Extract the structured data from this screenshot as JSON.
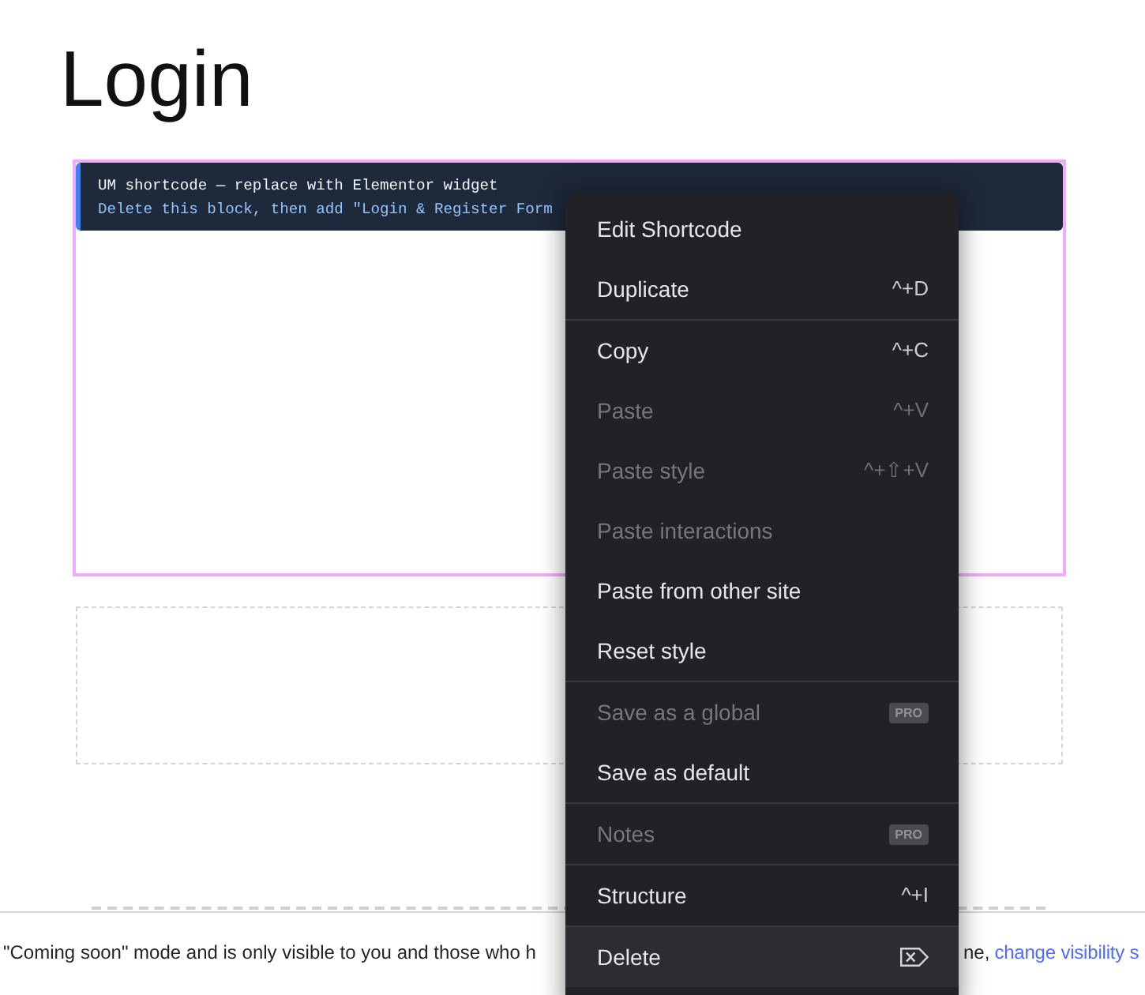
{
  "page": {
    "title": "Login"
  },
  "shortcode_block": {
    "selected": true,
    "lines": [
      {
        "text": "UM shortcode — replace with Elementor widget",
        "kind": "heading"
      },
      {
        "text": "Delete this block, then add \"Login & Register Form",
        "kind": "hint"
      }
    ]
  },
  "context_menu": {
    "groups": [
      {
        "items": [
          {
            "label": "Edit Shortcode",
            "kind": "plain",
            "disabled": false,
            "highlighted": false
          },
          {
            "label": "Duplicate",
            "kind": "shortcut",
            "shortcut": "^+D",
            "disabled": false,
            "highlighted": false
          }
        ]
      },
      {
        "items": [
          {
            "label": "Copy",
            "kind": "shortcut",
            "shortcut": "^+C",
            "disabled": false,
            "highlighted": false
          },
          {
            "label": "Paste",
            "kind": "shortcut",
            "shortcut": "^+V",
            "disabled": true,
            "highlighted": false
          },
          {
            "label": "Paste style",
            "kind": "shortcut",
            "shortcut": "^+⇧+V",
            "disabled": true,
            "highlighted": false
          },
          {
            "label": "Paste interactions",
            "kind": "plain",
            "disabled": true,
            "highlighted": false
          },
          {
            "label": "Paste from other site",
            "kind": "plain",
            "disabled": false,
            "highlighted": false
          },
          {
            "label": "Reset style",
            "kind": "plain",
            "disabled": false,
            "highlighted": false
          }
        ]
      },
      {
        "items": [
          {
            "label": "Save as a global",
            "kind": "badge",
            "badge": "PRO",
            "disabled": true,
            "highlighted": false
          },
          {
            "label": "Save as default",
            "kind": "plain",
            "disabled": false,
            "highlighted": false
          }
        ]
      },
      {
        "items": [
          {
            "label": "Notes",
            "kind": "badge",
            "badge": "PRO",
            "disabled": true,
            "highlighted": false
          }
        ]
      },
      {
        "items": [
          {
            "label": "Structure",
            "kind": "shortcut",
            "shortcut": "^+I",
            "disabled": false,
            "highlighted": false
          }
        ]
      },
      {
        "items": [
          {
            "label": "Delete",
            "kind": "key-icon",
            "disabled": false,
            "highlighted": true
          }
        ]
      }
    ]
  },
  "notice": {
    "text_start": "\"Coming soon\" mode and is only visible to you and those who h",
    "text_end": "ne,",
    "link": "change visibility s"
  }
}
